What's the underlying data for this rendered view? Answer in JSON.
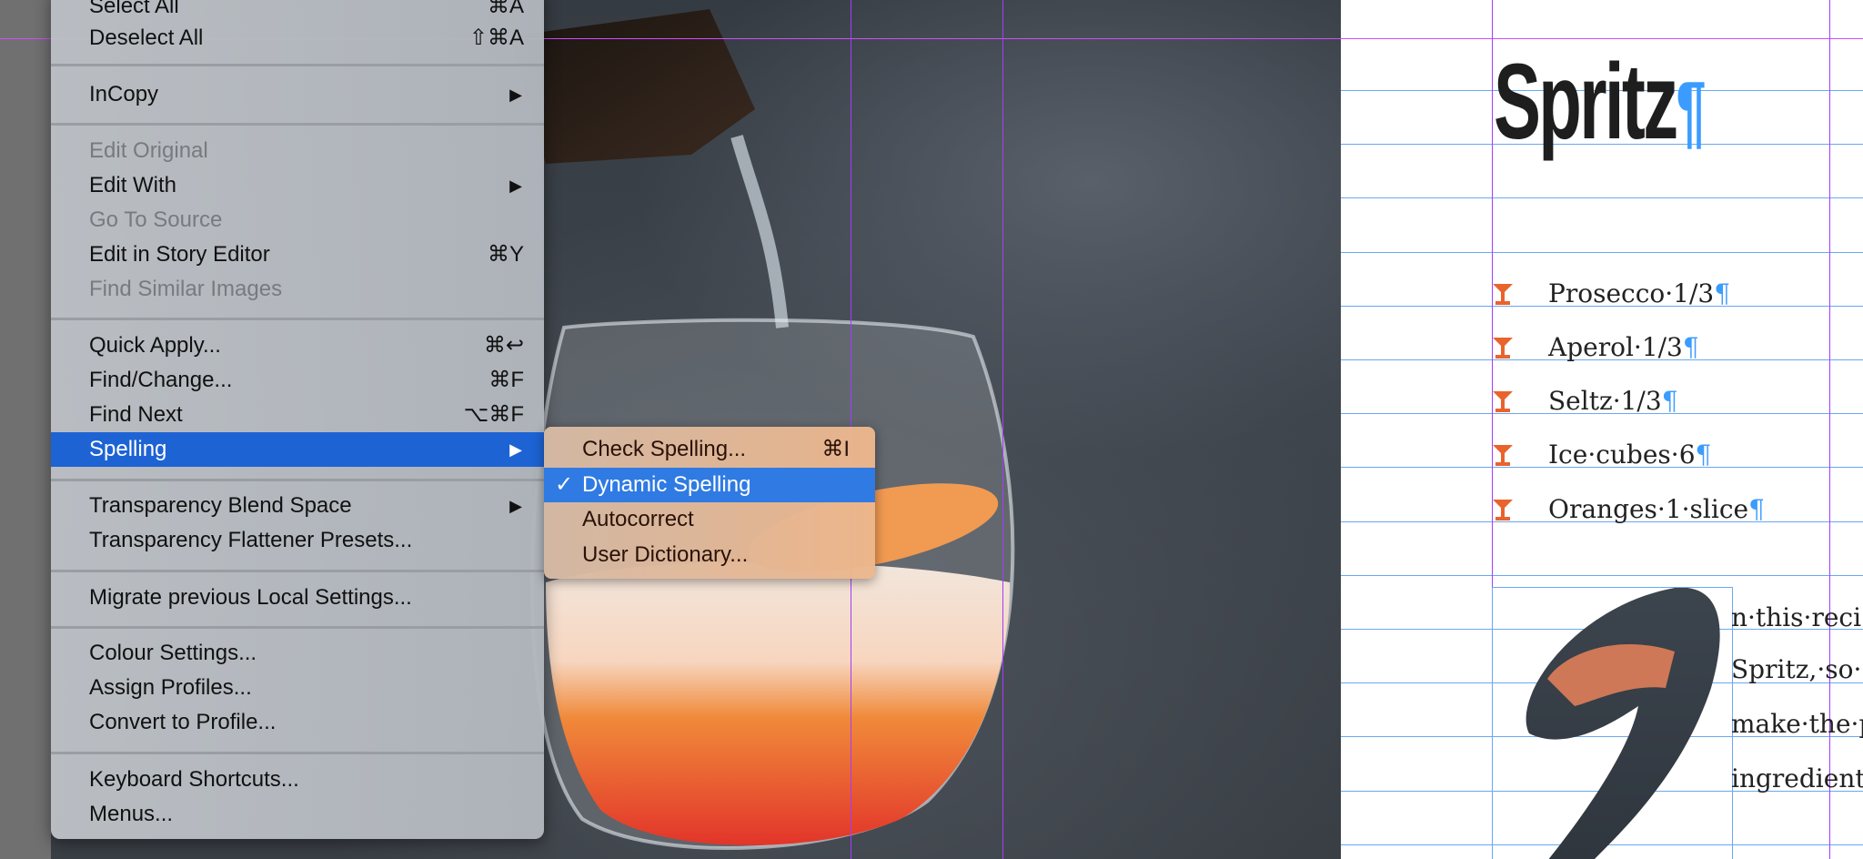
{
  "menu": {
    "items": [
      {
        "label": "Select All",
        "shortcut": "⌘A"
      },
      {
        "label": "Deselect All",
        "shortcut": "⇧⌘A"
      },
      {
        "label": "InCopy",
        "submenu": true
      },
      {
        "label": "Edit Original",
        "disabled": true
      },
      {
        "label": "Edit With",
        "submenu": true
      },
      {
        "label": "Go To Source",
        "disabled": true
      },
      {
        "label": "Edit in Story Editor",
        "shortcut": "⌘Y"
      },
      {
        "label": "Find Similar Images",
        "disabled": true
      },
      {
        "label": "Quick Apply...",
        "shortcut": "⌘↩"
      },
      {
        "label": "Find/Change...",
        "shortcut": "⌘F"
      },
      {
        "label": "Find Next",
        "shortcut": "⌥⌘F"
      },
      {
        "label": "Spelling",
        "submenu": true,
        "highlighted": true
      },
      {
        "label": "Transparency Blend Space",
        "submenu": true
      },
      {
        "label": "Transparency Flattener Presets..."
      },
      {
        "label": "Migrate previous Local Settings..."
      },
      {
        "label": "Colour Settings..."
      },
      {
        "label": "Assign Profiles..."
      },
      {
        "label": "Convert to Profile..."
      },
      {
        "label": "Keyboard Shortcuts..."
      },
      {
        "label": "Menus..."
      }
    ],
    "arrow": "▶"
  },
  "submenu": {
    "items": [
      {
        "label": "Check Spelling...",
        "shortcut": "⌘I"
      },
      {
        "label": "Dynamic Spelling",
        "checked": true,
        "check": "✓",
        "highlighted": true
      },
      {
        "label": "Autocorrect"
      },
      {
        "label": "User Dictionary..."
      }
    ]
  },
  "document": {
    "title": "Spritz",
    "pilcrow": "¶",
    "ingredients": [
      "Prosecco·1/3",
      "Aperol·1/3",
      "Seltz·1/3",
      "Ice·cubes·6",
      "Oranges·1·slice"
    ],
    "body_lines": [
      "n·this·reci",
      "Spritz,·so·",
      "make·the·p",
      "ingredient"
    ],
    "bullet_icon": "cocktail-glass-icon"
  },
  "colors": {
    "menu_highlight": "#1d63d4",
    "submenu_highlight": "#2f7be3",
    "bullet": "#e8642c",
    "pilcrow": "#3b9cff",
    "guide": "#a43bff",
    "baseline_grid": "#6aa8f0"
  }
}
